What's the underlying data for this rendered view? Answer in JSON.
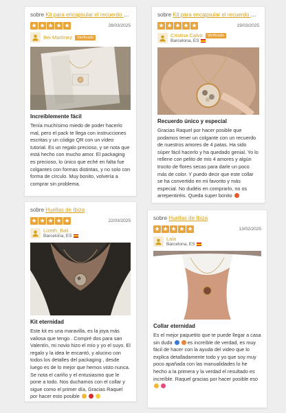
{
  "colors": {
    "accent": "#e8a33a",
    "link": "#d4a017",
    "background": "#eeeeee"
  },
  "reviews": [
    {
      "about_prefix": "sobre",
      "product": "Kit para encapsular el recuerdo de t...",
      "stars": [
        "★",
        "★",
        "★",
        "★",
        "★"
      ],
      "date": "28/03/2025",
      "reviewer": "Bei Martínez",
      "verified": "Verificado",
      "location": "",
      "title": "Increíblemente fácil",
      "body": "Tenía muchísimo miedo de poder hacerlo mal, pero el pack te llega con instrucciones escritas y un código QR con un vídeo tutorial. Es un regalo precioso, y se nota que está hecho con mucho amor. El packaging es precioso, lo único que eché en falta fue colgantes con formas distintas, y no solo con forma de círculo. Muy bonito, volvería a comprar sin problema."
    },
    {
      "about_prefix": "sobre",
      "product": "Kit para encapsular el recuerdo de t...",
      "stars": [
        "★",
        "★",
        "★",
        "★",
        "★"
      ],
      "date": "19/03/2025",
      "reviewer": "Cristina Calvo",
      "verified": "Verificado",
      "location": "Barcelona, ES",
      "title": "Recuerdo único y especial",
      "body": "Gracias Raquel por hacer posible que podamos tener un colgante con un recuerdo de nuestros amores de 4 patas. Ha sido súper fácil hacerlo y ha quedado genial. Yo lo rellene con pelito de mis 4 amores y algún trocito de flores secas para darle un poco más de color. Y puedo decir que este collar se ha convertido en mi favorito y más especial. No dudéis en comprarlo, no os arrepentiréis. Queda super bonito"
    },
    {
      "about_prefix": "sobre",
      "product": "Huellas de Ibiza",
      "stars": [
        "★",
        "★",
        "★",
        "★",
        "★"
      ],
      "date": "22/03/2025",
      "reviewer": "Lizeth_Bali",
      "verified": "",
      "location": "Barcelona, ES",
      "title": "Kit eternidad",
      "body": "Este kit es una maravilla, es la joya más valiosa que tengo . Compré dos para san Valentín, mi novio hizo el mío y yo el suyo. El regalo y la idea le encantó, y alucino con todos los detalles del packaging , desde luego es de lo mejor que hemos visto nunca. Se nota el cariño y el entusiasmo que le pone a todo. Nos duchamos con el collar y sigue como el primer día, Gracias Raquel por hacer esto posible"
    },
    {
      "about_prefix": "sobre",
      "product": "Huellas de Ibiza",
      "stars": [
        "★",
        "★",
        "★",
        "★",
        "★"
      ],
      "date": "13/02/2025",
      "reviewer": "Laia",
      "verified": "",
      "location": "Barcelona, ES",
      "title": "Collar eternidad",
      "body1": "Es el mejor paquetito que te puede llegar a casa sin duda",
      "body2": "es increíble de verdad, es muy fácil de hacer con la ayuda del video que lo explica detalladamente todo y yo que soy muy poco apañada con las manualidades lo he hecho a la primera y la verdad el resultado es increíble. Raquel gracias por hacer posible eso"
    }
  ]
}
